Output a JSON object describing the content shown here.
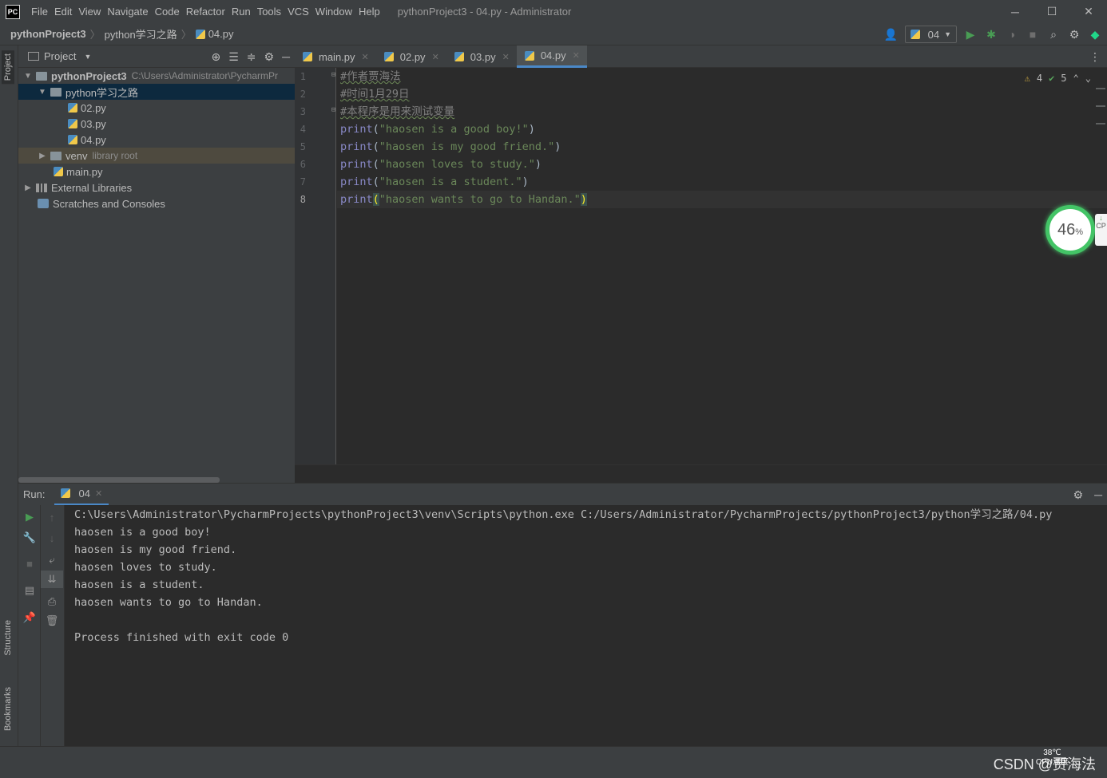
{
  "app": {
    "logo_text": "PC",
    "window_title": "pythonProject3 - 04.py - Administrator",
    "menu": [
      "File",
      "Edit",
      "View",
      "Navigate",
      "Code",
      "Refactor",
      "Run",
      "Tools",
      "VCS",
      "Window",
      "Help"
    ],
    "window_controls": {
      "minimize": "─",
      "maximize": "☐",
      "close": "✕"
    }
  },
  "navbar": {
    "breadcrumb": [
      "pythonProject3",
      "python学习之路",
      "04.py"
    ],
    "run_config": "04"
  },
  "left_stripe": {
    "project": "Project",
    "structure": "Structure",
    "bookmarks": "Bookmarks"
  },
  "project_panel": {
    "title": "Project",
    "tree": [
      {
        "label": "pythonProject3",
        "hint": "C:\\Users\\Administrator\\PycharmPr",
        "type": "folder",
        "expanded": true
      },
      {
        "label": "python学习之路",
        "type": "folder",
        "expanded": true,
        "selected": true
      },
      {
        "label": "02.py",
        "type": "py"
      },
      {
        "label": "03.py",
        "type": "py"
      },
      {
        "label": "04.py",
        "type": "py"
      },
      {
        "label": "venv",
        "hint": "library root",
        "type": "folder",
        "expanded": false
      },
      {
        "label": "main.py",
        "type": "py"
      },
      {
        "label": "External Libraries",
        "type": "lib",
        "expanded": false
      },
      {
        "label": "Scratches and Consoles",
        "type": "scratch"
      }
    ]
  },
  "editor": {
    "tabs": [
      "main.py",
      "02.py",
      "03.py",
      "04.py"
    ],
    "active_tab": "04.py",
    "inspections": {
      "warnings": "4",
      "ok": "5"
    },
    "line_numbers": [
      "1",
      "2",
      "3",
      "4",
      "5",
      "6",
      "7",
      "8"
    ],
    "comments": [
      "#作者贾海法",
      "#时间1月29日",
      "#本程序是用来测试变量"
    ],
    "prints": [
      {
        "fn": "print",
        "text": "\"haosen is a good boy!\""
      },
      {
        "fn": "print",
        "text": "\"haosen is my good friend.\""
      },
      {
        "fn": "print",
        "text": "\"haosen loves to study.\""
      },
      {
        "fn": "print",
        "text": "\"haosen is a student.\""
      },
      {
        "fn": "print",
        "text": "\"haosen wants to go to Handan.\""
      }
    ]
  },
  "cpu_widget": {
    "value": "46",
    "unit": "%",
    "side": "CP"
  },
  "run_panel": {
    "label": "Run:",
    "tab": "04",
    "console": [
      "C:\\Users\\Administrator\\PycharmProjects\\pythonProject3\\venv\\Scripts\\python.exe C:/Users/Administrator/PycharmProjects/pythonProject3/python学习之路/04.py",
      "haosen is a good boy!",
      "haosen is my good friend.",
      "haosen loves to study.",
      "haosen is a student.",
      "haosen wants to go to Handan.",
      "",
      "Process finished with exit code 0"
    ]
  },
  "statusbar": {
    "cpu_temp": "38℃",
    "cpu_temp_label": "CPU温度",
    "watermark": "CSDN @贾海法"
  },
  "colors": {
    "accent": "#4a88c7",
    "selection": "#0d293e",
    "string": "#6a8759",
    "keyword": "#8888c6",
    "comment": "#808080"
  }
}
